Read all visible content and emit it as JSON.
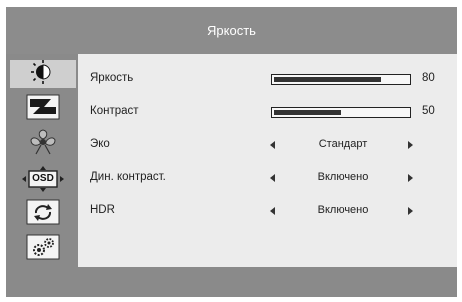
{
  "title": "Яркость",
  "sidebar": {
    "items": [
      {
        "icon": "brightness-icon",
        "active": true
      },
      {
        "icon": "picture-icon",
        "active": false
      },
      {
        "icon": "color-icon",
        "active": false
      },
      {
        "icon": "osd-settings-icon",
        "label": "OSD",
        "active": false
      },
      {
        "icon": "reset-icon",
        "active": false
      },
      {
        "icon": "system-settings-icon",
        "active": false
      }
    ]
  },
  "menu": {
    "brightness": {
      "label": "Яркость",
      "value": "80",
      "level": 0.8
    },
    "contrast": {
      "label": "Контраст",
      "value": "50",
      "level": 0.5
    },
    "eco": {
      "label": "Эко",
      "option": "Стандарт"
    },
    "dcr": {
      "label": "Дин. контраст.",
      "option": "Включено"
    },
    "hdr": {
      "label": "HDR",
      "option": "Включено"
    }
  },
  "colors": {
    "frame": "#8a8a8a",
    "panel": "#ececec",
    "highlight": "#cfcfcf",
    "text": "#222222"
  }
}
